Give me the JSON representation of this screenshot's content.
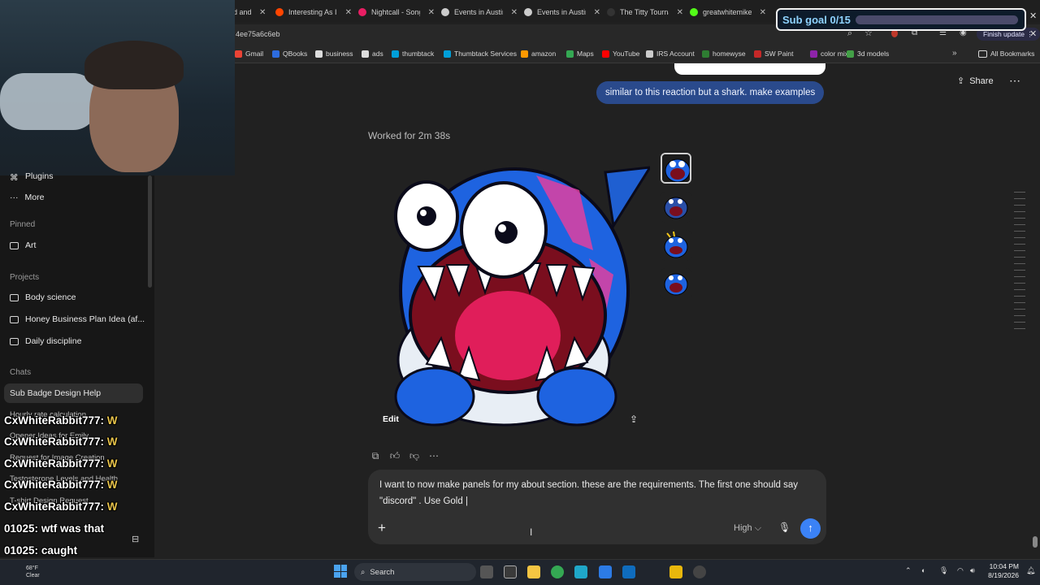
{
  "browser": {
    "tabs": [
      {
        "label": "d and",
        "color": "#888888"
      },
      {
        "label": "Interesting As I",
        "color": "#ff4500"
      },
      {
        "label": "Nightcall - Song",
        "color": "#e91e63"
      },
      {
        "label": "Events in Austin",
        "color": "#cccccc"
      },
      {
        "label": "Events in Austin",
        "color": "#cccccc"
      },
      {
        "label": "The Titty Tourna",
        "color": "#333333"
      },
      {
        "label": "greatwhitemike",
        "color": "#53fc18"
      }
    ],
    "url": "4ee75a6c6eb",
    "finish_update": "Finish update",
    "bookmarks": [
      {
        "label": "Gmail",
        "color": "#ea4335"
      },
      {
        "label": "QBooks",
        "color": "#2d6cdf"
      },
      {
        "label": "business",
        "color": "#dddddd"
      },
      {
        "label": "ads",
        "color": "#dddddd"
      },
      {
        "label": "thumbtack",
        "color": "#009fd9"
      },
      {
        "label": "Thumbtack Services",
        "color": "#009fd9"
      },
      {
        "label": "amazon",
        "color": "#ff9900"
      },
      {
        "label": "Maps",
        "color": "#34a853"
      },
      {
        "label": "YouTube",
        "color": "#ff0000"
      },
      {
        "label": "IRS Account",
        "color": "#cccccc"
      },
      {
        "label": "homewyse",
        "color": "#2e7d32"
      },
      {
        "label": "SW Paint",
        "color": "#c62828"
      },
      {
        "label": "color mix",
        "color": "#8e24aa"
      },
      {
        "label": "3d models",
        "color": "#43a047"
      }
    ],
    "all_bookmarks": "All Bookmarks"
  },
  "overlay": {
    "subgoal": "Sub goal 0/15",
    "subgoal_progress": 0,
    "chat": [
      {
        "user": "CxWhiteRabbit777:",
        "msg": "W"
      },
      {
        "user": "CxWhiteRabbit777:",
        "msg": "W"
      },
      {
        "user": "CxWhiteRabbit777:",
        "msg": "W"
      },
      {
        "user": "CxWhiteRabbit777:",
        "msg": "W"
      },
      {
        "user": "CxWhiteRabbit777:",
        "msg": "W"
      },
      {
        "user": "01025:",
        "msg": "wtf was that"
      },
      {
        "user": "01025:",
        "msg": "caught"
      }
    ]
  },
  "sidebar": {
    "plugins": "Plugins",
    "more": "More",
    "pinned_header": "Pinned",
    "pinned": [
      "Art"
    ],
    "projects_header": "Projects",
    "projects": [
      "Body science",
      "Honey Business Plan Idea (af...",
      "Daily discipline"
    ],
    "chats_header": "Chats",
    "chats": [
      "Sub Badge Design Help",
      "Hourly rate calculation",
      "Opener Ideas for Emily",
      "Request for Image Creation",
      "Testosterone Levels and Health",
      "T-shirt Design Request"
    ]
  },
  "main": {
    "share": "Share",
    "user_message": "similar to this reaction but a shark. make examples",
    "worked_for": "Worked for 2m 38s",
    "edit": "Edit",
    "composer_text": "I want to now make panels for my about section. these are the requirements. The first one should say \"discord\" . Use Gold |",
    "model": "High"
  },
  "taskbar": {
    "weather_temp": "68°F",
    "weather_cond": "Clear",
    "search": "Search",
    "time": "10:04 PM",
    "date": "8/19/2026"
  }
}
